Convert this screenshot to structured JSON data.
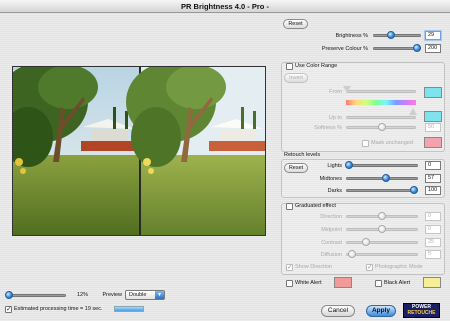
{
  "window": {
    "title": "PR Brightness 4.0 - Pro -"
  },
  "top": {
    "reset_label": "Reset"
  },
  "brightness": {
    "label": "Brightness %",
    "value": "29",
    "level_pct": 40
  },
  "preserve_colour": {
    "label": "Preserve Colour %",
    "value": "200",
    "level_pct": 100
  },
  "color_range": {
    "checkbox_label": "Use Color Range",
    "checked": false,
    "invert_label": "Invert",
    "from_label": "From",
    "from_color": "#7fe3ee",
    "upto_label": "Up to",
    "upto_color": "#7fe3ee",
    "softness_label": "Softness %",
    "softness_value": "50",
    "mask_label": "Mask unchanged",
    "mask_color": "#f2a3ad"
  },
  "retouch": {
    "header": "Retouch levels",
    "reset_label": "Reset",
    "lights_label": "Lights",
    "lights_value": "0",
    "midtones_label": "Midtones",
    "midtones_value": "57",
    "darks_label": "Darks",
    "darks_value": "100"
  },
  "graduated": {
    "checkbox_label": "Graduated effect",
    "checked": false,
    "direction_label": "Direction",
    "direction_value": "0",
    "midpoint_label": "Midpoint",
    "midpoint_value": "0",
    "contrast_label": "Contrast",
    "contrast_value": "25",
    "diffusion_label": "Diffusion",
    "diffusion_value": "5",
    "show_direction_label": "Show Direction",
    "show_direction_checked": true,
    "photographic_label": "Photographic Mode",
    "photographic_checked": true
  },
  "alerts": {
    "white_label": "White Alert",
    "white_color": "#f29a9a",
    "black_label": "Black Alert",
    "black_color": "#f7ee98"
  },
  "zoom": {
    "value": "12%",
    "level_pct": 5
  },
  "preview": {
    "label": "Preview",
    "selected": "Double"
  },
  "estimate": {
    "label": "Estimated processing time = 19 sec.",
    "checked": true
  },
  "buttons": {
    "cancel": "Cancel",
    "apply": "Apply"
  },
  "logo": {
    "line1": "POWER",
    "line2": "RETOUCHE"
  }
}
